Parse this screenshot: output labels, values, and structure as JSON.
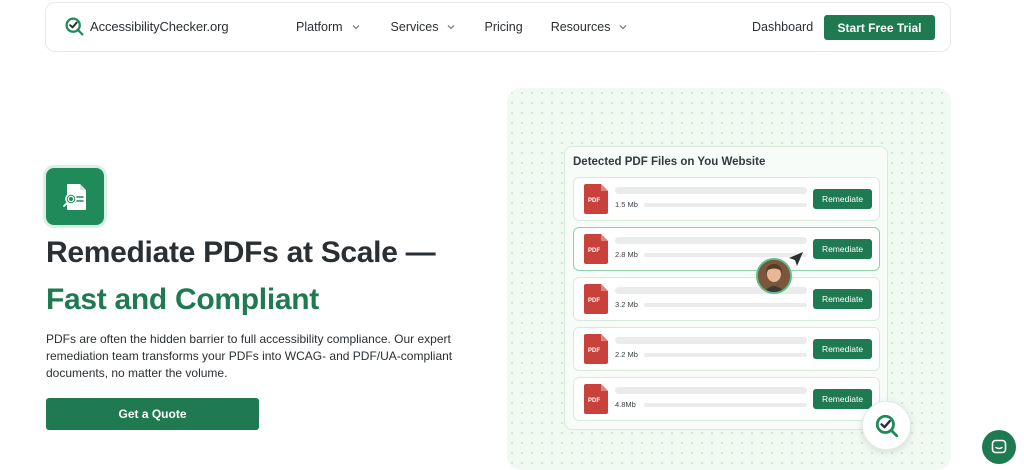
{
  "nav": {
    "logo_text": "AccessibilityChecker.org",
    "links": [
      {
        "label": "Platform",
        "has_dropdown": true
      },
      {
        "label": "Services",
        "has_dropdown": true
      },
      {
        "label": "Pricing",
        "has_dropdown": false
      },
      {
        "label": "Resources",
        "has_dropdown": true
      }
    ],
    "dashboard_label": "Dashboard",
    "cta_label": "Start Free Trial"
  },
  "hero": {
    "title_line1": "Remediate PDFs at Scale —",
    "title_line2": "Fast and Compliant",
    "description": "PDFs are often the hidden barrier to full accessibility compliance. Our expert remediation team transforms your PDFs into WCAG- and PDF/UA-compliant documents, no matter the volume.",
    "cta_label": "Get a Quote"
  },
  "illustration": {
    "panel_title": "Detected PDF Files on You Website",
    "files": [
      {
        "icon_label": "PDF",
        "size": "1.5 Mb",
        "action": "Remediate"
      },
      {
        "icon_label": "PDF",
        "size": "2.8 Mb",
        "action": "Remediate"
      },
      {
        "icon_label": "PDF",
        "size": "3.2 Mb",
        "action": "Remediate"
      },
      {
        "icon_label": "PDF",
        "size": "2.2 Mb",
        "action": "Remediate"
      },
      {
        "icon_label": "PDF",
        "size": "4.8Mb",
        "action": "Remediate"
      }
    ]
  },
  "colors": {
    "brand_green": "#1f7a52",
    "pdf_red": "#c8413b",
    "heading_dark": "#2a2f33"
  },
  "icons": [
    "logo-check-icon",
    "chevron-down-icon",
    "pdf-search-icon",
    "pdf-file-icon",
    "cursor-arrow-icon",
    "check-badge-icon",
    "chat-icon"
  ]
}
